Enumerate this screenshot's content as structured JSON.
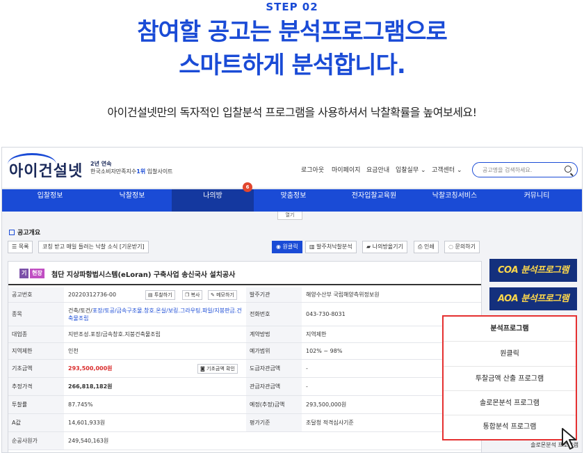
{
  "hero": {
    "step": "STEP 02",
    "headline_line1": "참여할 공고는 분석프로그램으로",
    "headline_line2": "스마트하게 분석합니다.",
    "subtitle": "아이건설넷만의 독자적인 입찰분석 프로그램을 사용하셔서 낙찰확률을 높여보세요!"
  },
  "site": {
    "logo": "아이건설넷",
    "badge_line1": "2년 연속",
    "badge_line2_prefix": "한국소비자만족지수",
    "badge_line2_rank": "1위",
    "badge_line2_suffix": "입찰사이트",
    "util_links": [
      "로그아웃",
      "마이페이지",
      "요금안내",
      "입찰실무 ⌄",
      "고객센터 ⌄"
    ],
    "search_placeholder": "공고명을 검색하세요.",
    "nav": [
      "입찰정보",
      "낙찰정보",
      "나의방",
      "맞춤정보",
      "전자입찰교육원",
      "낙찰코칭서비스",
      "커뮤니티"
    ],
    "nav_active_index": 2,
    "nav_badge": "6",
    "open_tab": "열기"
  },
  "notice": {
    "section_title": "공고개요",
    "toolbar_left": [
      "☰ 목록",
      "코칭 받고 매일 들려는 낙찰 소식 [기운받기]"
    ],
    "toolbar_right": [
      "원클릭",
      "발주처낙찰분석",
      "나의방옮기기",
      "인쇄",
      "문의하기"
    ],
    "tags": [
      "기",
      "현장"
    ],
    "title": "첨단 지상파항법시스템(eLoran) 구축사업 송신국사 설치공사",
    "rows": [
      {
        "label": "공고번호",
        "value": "20220312736-00",
        "label2": "발주기관",
        "value2": "해양수산부 국립해양측위정보원",
        "buttons": [
          "투찰하기",
          "복사",
          "메모하기"
        ]
      },
      {
        "label": "종목",
        "value_plain": "건축/토건/",
        "value_blue": "포장/토공/금속구조물.창호.온실/보링.그라우팅.파일/지붕판금.건축물조립",
        "label2": "전화번호",
        "value2": "043-730-8031"
      },
      {
        "label": "대업종",
        "value": "지반조성.포장/금속창호.지붕건축물조립",
        "label2": "계약방법",
        "value2": "지역제한"
      },
      {
        "label": "지역제한",
        "value": "인천",
        "label2": "예가범위",
        "value2": "102% ~ 98%"
      },
      {
        "label": "기초금액",
        "value": "293,500,000원",
        "label2": "도급자관금액",
        "value2": "-",
        "buttons": [
          "기초금액 확인"
        ]
      },
      {
        "label": "추정가격",
        "value": "266,818,182원",
        "label2": "관급자관금액",
        "value2": "-"
      },
      {
        "label": "투찰률",
        "value": "87.745%",
        "label2": "예정(추정)금액",
        "value2": "293,500,000원"
      },
      {
        "label": "A값",
        "value": "14,601,933원",
        "label2": "평가기준",
        "value2": "조달청 적격심사기준"
      },
      {
        "label": "순공사원가",
        "value": "249,540,163원",
        "label2": "",
        "value2": ""
      }
    ]
  },
  "side": {
    "coa": "COA 분석프로그램",
    "aoa": "AOA 분석프로그램"
  },
  "popup": {
    "header": "분석프로그램",
    "items": [
      "원클릭",
      "투찰금액 산출 프로그램",
      "솔로몬분석 프로그램",
      "통합분석 프로그램"
    ],
    "underneath": "솔로몬분석 프로그램"
  },
  "colors": {
    "brand": "#1a4bd6",
    "nav_active": "#14389f",
    "highlight_border": "#e53030",
    "price_red": "#d92c2c"
  }
}
